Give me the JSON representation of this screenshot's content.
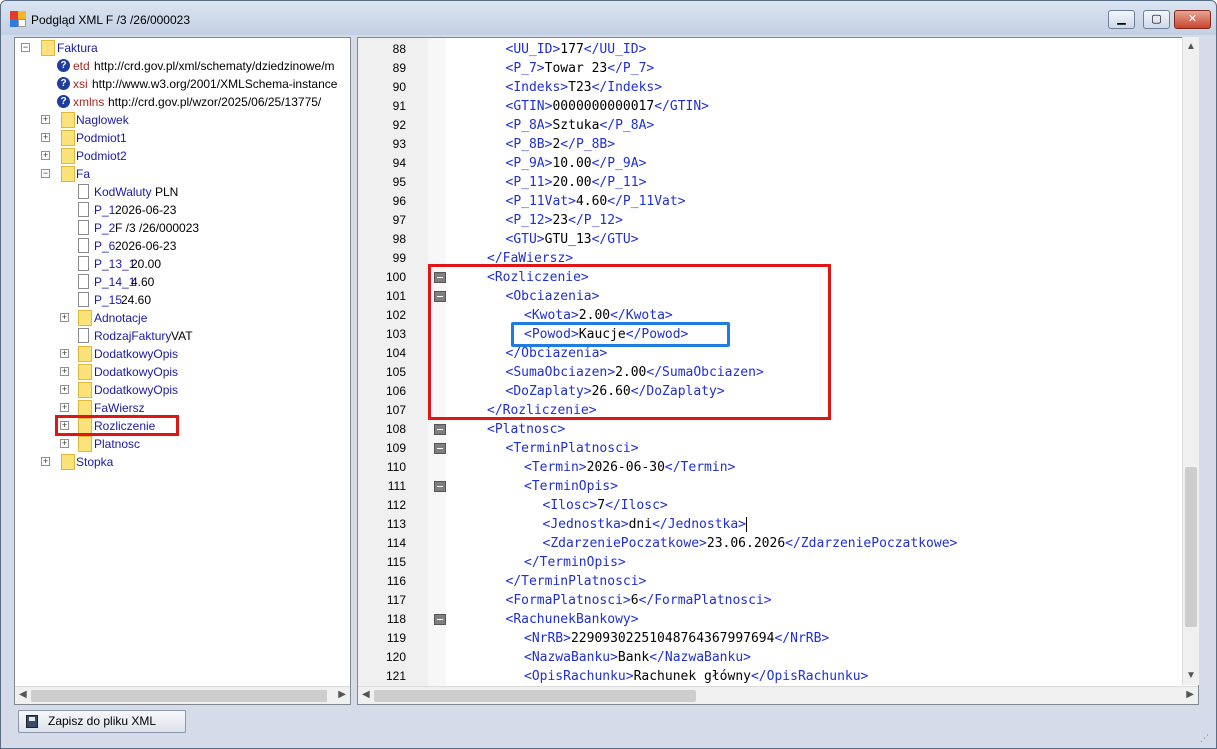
{
  "window": {
    "title": "Podgląd XML F /3  /26/000023",
    "min_glyph": "▁",
    "max_glyph": "▢",
    "close_glyph": "✕"
  },
  "tree": {
    "root": {
      "label": "Faktura"
    },
    "attrs": [
      {
        "name": "etd",
        "value": "http://crd.gov.pl/xml/schematy/dziedzinowe/m"
      },
      {
        "name": "xsi",
        "value": "http://www.w3.org/2001/XMLSchema-instance"
      },
      {
        "name": "xmlns",
        "value": "http://crd.gov.pl/wzor/2025/06/25/13775/"
      }
    ],
    "level1": [
      "Naglowek",
      "Podmiot1",
      "Podmiot2",
      "Fa"
    ],
    "fa_children": [
      {
        "name": "KodWaluty",
        "value": "PLN",
        "kind": "file",
        "color": "blue"
      },
      {
        "name": "P_1",
        "value": "2026-06-23",
        "kind": "file",
        "color": "blue"
      },
      {
        "name": "P_2",
        "value": "F /3  /26/000023",
        "kind": "file",
        "color": "blue"
      },
      {
        "name": "P_6",
        "value": "2026-06-23",
        "kind": "file",
        "color": "blue"
      },
      {
        "name": "P_13_1",
        "value": "20.00",
        "kind": "file",
        "color": "blue"
      },
      {
        "name": "P_14_1",
        "value": "4.60",
        "kind": "file",
        "color": "blue"
      },
      {
        "name": "P_15",
        "value": "24.60",
        "kind": "file",
        "color": "blue"
      },
      {
        "name": "Adnotacje",
        "value": "",
        "kind": "folder",
        "color": "blue"
      },
      {
        "name": "RodzajFaktury",
        "value": "VAT",
        "kind": "file",
        "color": "blue"
      },
      {
        "name": "DodatkowyOpis",
        "value": "",
        "kind": "folder",
        "color": "blue"
      },
      {
        "name": "DodatkowyOpis",
        "value": "",
        "kind": "folder",
        "color": "blue"
      },
      {
        "name": "DodatkowyOpis",
        "value": "",
        "kind": "folder",
        "color": "blue"
      },
      {
        "name": "FaWiersz",
        "value": "",
        "kind": "folder",
        "color": "blue"
      },
      {
        "name": "Rozliczenie",
        "value": "",
        "kind": "folder",
        "color": "blue"
      },
      {
        "name": "Platnosc",
        "value": "",
        "kind": "folder",
        "color": "blue"
      }
    ],
    "stopka": "Stopka"
  },
  "editor": {
    "lines": [
      {
        "n": "88",
        "indent": 3,
        "parts": [
          [
            "t",
            "<UU_ID>"
          ],
          [
            "v",
            "177"
          ],
          [
            "t",
            "</UU_ID>"
          ]
        ]
      },
      {
        "n": "89",
        "indent": 3,
        "parts": [
          [
            "t",
            "<P_7>"
          ],
          [
            "v",
            "Towar 23"
          ],
          [
            "t",
            "</P_7>"
          ]
        ]
      },
      {
        "n": "90",
        "indent": 3,
        "parts": [
          [
            "t",
            "<Indeks>"
          ],
          [
            "v",
            "T23"
          ],
          [
            "t",
            "</Indeks>"
          ]
        ]
      },
      {
        "n": "91",
        "indent": 3,
        "parts": [
          [
            "t",
            "<GTIN>"
          ],
          [
            "v",
            "0000000000017"
          ],
          [
            "t",
            "</GTIN>"
          ]
        ]
      },
      {
        "n": "92",
        "indent": 3,
        "parts": [
          [
            "t",
            "<P_8A>"
          ],
          [
            "v",
            "Sztuka"
          ],
          [
            "t",
            "</P_8A>"
          ]
        ]
      },
      {
        "n": "93",
        "indent": 3,
        "parts": [
          [
            "t",
            "<P_8B>"
          ],
          [
            "v",
            "2"
          ],
          [
            "t",
            "</P_8B>"
          ]
        ]
      },
      {
        "n": "94",
        "indent": 3,
        "parts": [
          [
            "t",
            "<P_9A>"
          ],
          [
            "v",
            "10.00"
          ],
          [
            "t",
            "</P_9A>"
          ]
        ]
      },
      {
        "n": "95",
        "indent": 3,
        "parts": [
          [
            "t",
            "<P_11>"
          ],
          [
            "v",
            "20.00"
          ],
          [
            "t",
            "</P_11>"
          ]
        ]
      },
      {
        "n": "96",
        "indent": 3,
        "parts": [
          [
            "t",
            "<P_11Vat>"
          ],
          [
            "v",
            "4.60"
          ],
          [
            "t",
            "</P_11Vat>"
          ]
        ]
      },
      {
        "n": "97",
        "indent": 3,
        "parts": [
          [
            "t",
            "<P_12>"
          ],
          [
            "v",
            "23"
          ],
          [
            "t",
            "</P_12>"
          ]
        ]
      },
      {
        "n": "98",
        "indent": 3,
        "parts": [
          [
            "t",
            "<GTU>"
          ],
          [
            "v",
            "GTU_13"
          ],
          [
            "t",
            "</GTU>"
          ]
        ]
      },
      {
        "n": "99",
        "indent": 2,
        "parts": [
          [
            "t",
            "</FaWiersz>"
          ]
        ]
      },
      {
        "n": "100",
        "indent": 2,
        "fold": true,
        "parts": [
          [
            "t",
            "<Rozliczenie>"
          ]
        ]
      },
      {
        "n": "101",
        "indent": 3,
        "fold": true,
        "parts": [
          [
            "t",
            "<Obciazenia>"
          ]
        ]
      },
      {
        "n": "102",
        "indent": 4,
        "parts": [
          [
            "t",
            "<Kwota>"
          ],
          [
            "v",
            "2.00"
          ],
          [
            "t",
            "</Kwota>"
          ]
        ]
      },
      {
        "n": "103",
        "indent": 4,
        "parts": [
          [
            "t",
            "<Powod>"
          ],
          [
            "v",
            "Kaucje"
          ],
          [
            "t",
            "</Powod>"
          ]
        ]
      },
      {
        "n": "104",
        "indent": 3,
        "parts": [
          [
            "t",
            "</Obciazenia>"
          ]
        ]
      },
      {
        "n": "105",
        "indent": 3,
        "parts": [
          [
            "t",
            "<SumaObciazen>"
          ],
          [
            "v",
            "2.00"
          ],
          [
            "t",
            "</SumaObciazen>"
          ]
        ]
      },
      {
        "n": "106",
        "indent": 3,
        "parts": [
          [
            "t",
            "<DoZaplaty>"
          ],
          [
            "v",
            "26.60"
          ],
          [
            "t",
            "</DoZaplaty>"
          ]
        ]
      },
      {
        "n": "107",
        "indent": 2,
        "parts": [
          [
            "t",
            "</Rozliczenie>"
          ]
        ]
      },
      {
        "n": "108",
        "indent": 2,
        "fold": true,
        "parts": [
          [
            "t",
            "<Platnosc>"
          ]
        ]
      },
      {
        "n": "109",
        "indent": 3,
        "fold": true,
        "parts": [
          [
            "t",
            "<TerminPlatnosci>"
          ]
        ]
      },
      {
        "n": "110",
        "indent": 4,
        "parts": [
          [
            "t",
            "<Termin>"
          ],
          [
            "v",
            "2026-06-30"
          ],
          [
            "t",
            "</Termin>"
          ]
        ]
      },
      {
        "n": "111",
        "indent": 4,
        "fold": true,
        "parts": [
          [
            "t",
            "<TerminOpis>"
          ]
        ]
      },
      {
        "n": "112",
        "indent": 5,
        "parts": [
          [
            "t",
            "<Ilosc>"
          ],
          [
            "v",
            "7"
          ],
          [
            "t",
            "</Ilosc>"
          ]
        ]
      },
      {
        "n": "113",
        "indent": 5,
        "caret": true,
        "parts": [
          [
            "t",
            "<Jednostka>"
          ],
          [
            "v",
            "dni"
          ],
          [
            "t",
            "</Jednostka>"
          ]
        ]
      },
      {
        "n": "114",
        "indent": 5,
        "parts": [
          [
            "t",
            "<ZdarzeniePoczatkowe>"
          ],
          [
            "v",
            "23.06.2026"
          ],
          [
            "t",
            "</ZdarzeniePoczatkowe>"
          ]
        ]
      },
      {
        "n": "115",
        "indent": 4,
        "parts": [
          [
            "t",
            "</TerminOpis>"
          ]
        ]
      },
      {
        "n": "116",
        "indent": 3,
        "parts": [
          [
            "t",
            "</TerminPlatnosci>"
          ]
        ]
      },
      {
        "n": "117",
        "indent": 3,
        "parts": [
          [
            "t",
            "<FormaPlatnosci>"
          ],
          [
            "v",
            "6"
          ],
          [
            "t",
            "</FormaPlatnosci>"
          ]
        ]
      },
      {
        "n": "118",
        "indent": 3,
        "fold": true,
        "parts": [
          [
            "t",
            "<RachunekBankowy>"
          ]
        ]
      },
      {
        "n": "119",
        "indent": 4,
        "parts": [
          [
            "t",
            "<NrRB>"
          ],
          [
            "v",
            "22909302251048764367997694"
          ],
          [
            "t",
            "</NrRB>"
          ]
        ]
      },
      {
        "n": "120",
        "indent": 4,
        "parts": [
          [
            "t",
            "<NazwaBanku>"
          ],
          [
            "v",
            "Bank"
          ],
          [
            "t",
            "</NazwaBanku>"
          ]
        ]
      },
      {
        "n": "121",
        "indent": 4,
        "parts": [
          [
            "t",
            "<OpisRachunku>"
          ],
          [
            "v",
            "Rachunek główny"
          ],
          [
            "t",
            "</OpisRachunku>"
          ]
        ]
      }
    ]
  },
  "footer": {
    "save_label": "Zapisz do pliku XML"
  },
  "colors": {
    "tag": "#1f2fd6",
    "highlight_red": "#e01515",
    "highlight_blue": "#1e7de0"
  }
}
